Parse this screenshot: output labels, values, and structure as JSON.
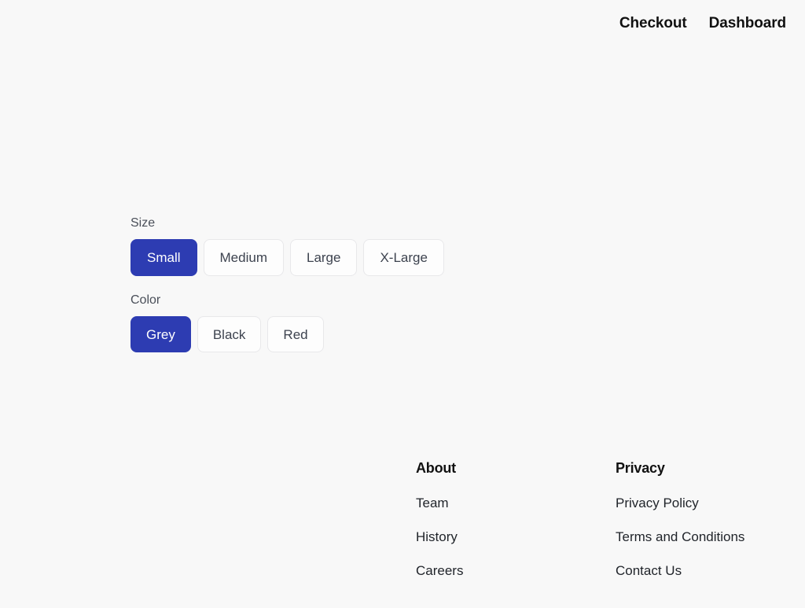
{
  "page": {
    "background_color": "#f8f8f8",
    "accent_color": "#2d3cb2"
  },
  "topnav": {
    "links": [
      {
        "label": "Checkout"
      },
      {
        "label": "Dashboard"
      }
    ]
  },
  "options": {
    "groups": [
      {
        "label": "Size",
        "selected": "Small",
        "choices": [
          {
            "label": "Small",
            "selected": true
          },
          {
            "label": "Medium",
            "selected": false
          },
          {
            "label": "Large",
            "selected": false
          },
          {
            "label": "X-Large",
            "selected": false
          }
        ]
      },
      {
        "label": "Color",
        "selected": "Grey",
        "choices": [
          {
            "label": "Grey",
            "selected": true
          },
          {
            "label": "Black",
            "selected": false
          },
          {
            "label": "Red",
            "selected": false
          }
        ]
      }
    ]
  },
  "footer": {
    "columns": [
      {
        "heading": "About",
        "links": [
          {
            "label": "Team"
          },
          {
            "label": "History"
          },
          {
            "label": "Careers"
          }
        ]
      },
      {
        "heading": "Privacy",
        "links": [
          {
            "label": "Privacy Policy"
          },
          {
            "label": "Terms and Conditions"
          },
          {
            "label": "Contact Us"
          }
        ]
      }
    ]
  }
}
